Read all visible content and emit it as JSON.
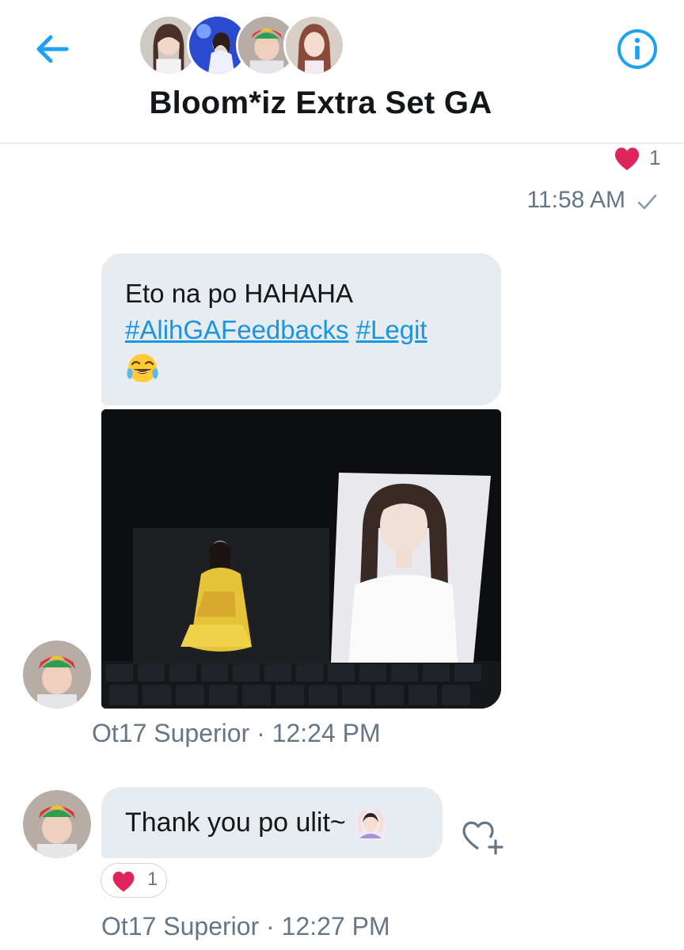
{
  "header": {
    "title": "Bloom*iz Extra Set GA",
    "back_icon": "arrow-left-icon",
    "info_icon": "info-icon",
    "accent": "#1da1f2"
  },
  "sent_message": {
    "reaction_count": "1",
    "time": "11:58 AM"
  },
  "messages": [
    {
      "text": "Eto na po HAHAHA",
      "hashtags": [
        "#AlihGAFeedbacks",
        "#Legit"
      ],
      "emoji": "face-with-tears-of-joy",
      "has_photo": true,
      "sender": "Ot17 Superior",
      "time": "12:24 PM",
      "meta": "Ot17 Superior · 12:24 PM"
    },
    {
      "text": "Thank you po ulit~",
      "emoji": "person-gesturing-ok",
      "reaction_count": "1",
      "sender": "Ot17 Superior",
      "time": "12:27 PM",
      "meta": "Ot17 Superior · 12:27 PM"
    }
  ],
  "colors": {
    "bubble": "#e6ecf0",
    "link": "#1b95e0",
    "heart": "#e0245e",
    "meta_text": "#657786"
  }
}
